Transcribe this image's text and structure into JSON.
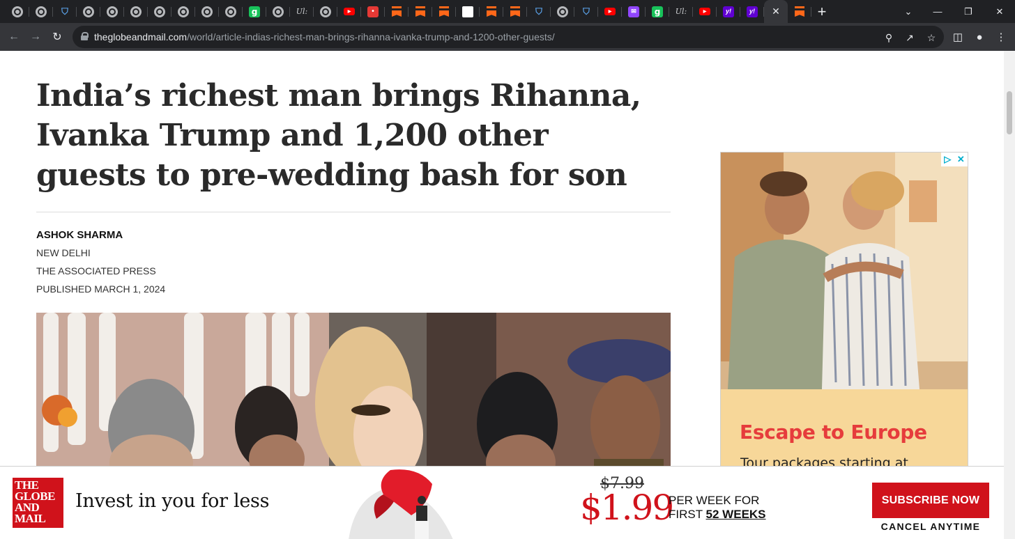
{
  "browser": {
    "tabs": [
      {
        "icon": "globe-icon",
        "glyph": ""
      },
      {
        "icon": "globe-icon",
        "glyph": ""
      },
      {
        "icon": "shield-icon",
        "glyph": "⛉"
      },
      {
        "icon": "globe-icon",
        "glyph": ""
      },
      {
        "icon": "globe-icon",
        "glyph": ""
      },
      {
        "icon": "globe-icon",
        "glyph": ""
      },
      {
        "icon": "globe-icon",
        "glyph": ""
      },
      {
        "icon": "globe-icon",
        "glyph": ""
      },
      {
        "icon": "globe-icon",
        "glyph": ""
      },
      {
        "icon": "globe-icon",
        "glyph": ""
      },
      {
        "icon": "g-icon",
        "glyph": "g"
      },
      {
        "icon": "globe-icon",
        "glyph": ""
      },
      {
        "icon": "italic-logo-icon",
        "glyph": "Ul:"
      },
      {
        "icon": "globe-icon",
        "glyph": ""
      },
      {
        "icon": "youtube-icon",
        "glyph": "▶"
      },
      {
        "icon": "podcast-icon",
        "glyph": "•"
      },
      {
        "icon": "substack-icon",
        "glyph": ""
      },
      {
        "icon": "substack-icon",
        "glyph": ""
      },
      {
        "icon": "substack-icon",
        "glyph": ""
      },
      {
        "icon": "document-icon",
        "glyph": ""
      },
      {
        "icon": "substack-icon",
        "glyph": ""
      },
      {
        "icon": "substack-icon",
        "glyph": ""
      },
      {
        "icon": "shield-icon",
        "glyph": "⛉"
      },
      {
        "icon": "globe-icon",
        "glyph": ""
      },
      {
        "icon": "shield-icon",
        "glyph": "⛉"
      },
      {
        "icon": "youtube-icon",
        "glyph": "▶"
      },
      {
        "icon": "twitch-icon",
        "glyph": "✉"
      },
      {
        "icon": "g-icon",
        "glyph": "g"
      },
      {
        "icon": "italic-logo-icon",
        "glyph": "Ul:"
      },
      {
        "icon": "youtube-icon",
        "glyph": "▶"
      },
      {
        "icon": "yahoo-icon",
        "glyph": "y!"
      },
      {
        "icon": "yahoo-icon",
        "glyph": "y!"
      },
      {
        "icon": "close-icon",
        "glyph": "✕",
        "active": true
      },
      {
        "icon": "substack-icon",
        "glyph": ""
      }
    ],
    "new_tab_glyph": "+",
    "url_host": "theglobeandmail.com",
    "url_path": "/world/article-indias-richest-man-brings-rihanna-ivanka-trump-and-1200-other-guests/"
  },
  "article": {
    "headline": "India’s richest man brings Rihanna, Ivanka Trump and 1,200 other guests to pre-wedding bash for son",
    "author": "ASHOK SHARMA",
    "location": "NEW DELHI",
    "agency": "THE ASSOCIATED PRESS",
    "published": "PUBLISHED MARCH 1, 2024"
  },
  "ad": {
    "title": "Escape to Europe",
    "subtitle": "Tour packages starting at"
  },
  "promo": {
    "logo_lines": [
      "THE",
      "GLOBE",
      "AND",
      "MAIL"
    ],
    "tagline": "Invest in you for less",
    "old_price": "$7.99",
    "new_price": "$1.99",
    "per_week": "PER WEEK FOR",
    "first": "FIRST",
    "weeks": "52 WEEKS",
    "subscribe": "SUBSCRIBE NOW",
    "cancel": "CANCEL ANYTIME"
  },
  "colors": {
    "brand_red": "#d0121b",
    "ad_accent": "#e63c3c",
    "chrome_dark": "#202124",
    "chrome_toolbar": "#35363a"
  }
}
